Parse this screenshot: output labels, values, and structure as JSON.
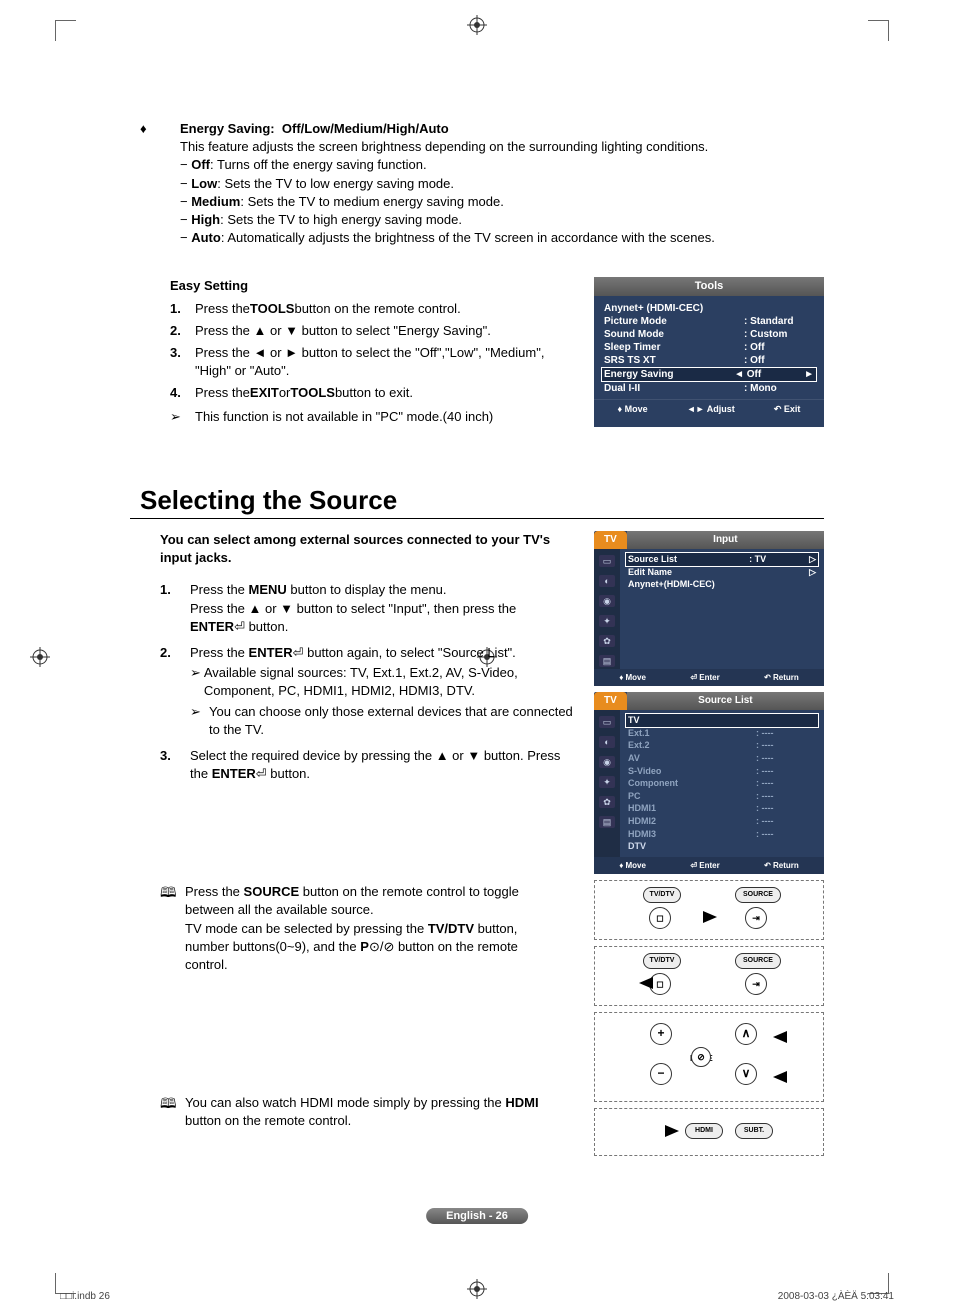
{
  "section1": {
    "title_label": "Energy Saving:",
    "title_options": "Off/Low/Medium/High/Auto",
    "desc": "This feature adjusts the screen brightness depending on the surrounding lighting conditions.",
    "items": [
      {
        "k": "Off",
        "v": ": Turns off the energy saving function."
      },
      {
        "k": "Low",
        "v": ": Sets the TV to low energy saving mode."
      },
      {
        "k": "Medium",
        "v": ": Sets the TV to medium energy saving mode."
      },
      {
        "k": "High",
        "v": ": Sets the TV to high energy saving mode."
      },
      {
        "k": "Auto",
        "v": ": Automatically adjusts the brightness of the TV screen in accordance with the scenes."
      }
    ]
  },
  "easy": {
    "heading": "Easy Setting",
    "steps": [
      {
        "n": "1.",
        "pre": "Press the ",
        "b": "TOOLS",
        "post": " button on the remote control."
      },
      {
        "n": "2.",
        "pre": "Press the ▲ or ▼ button to select \"Energy Saving\".",
        "b": "",
        "post": ""
      },
      {
        "n": "3.",
        "pre": "Press the ◄ or ► button to select the \"Off\",\"Low\", \"Medium\", \"High\" or \"Auto\".",
        "b": "",
        "post": ""
      },
      {
        "n": "4.",
        "pre": "Press the ",
        "b": "EXIT",
        "mid": " or ",
        "b2": "TOOLS",
        "post": " button to exit."
      }
    ],
    "note": "This function is not available in \"PC\" mode.(40 inch)"
  },
  "tools": {
    "title": "Tools",
    "rows": [
      {
        "l": "Anynet+ (HDMI-CEC)",
        "v": ""
      },
      {
        "l": "Picture Mode",
        "v": ": Standard"
      },
      {
        "l": "Sound Mode",
        "v": ": Custom"
      },
      {
        "l": "Sleep Timer",
        "v": ": Off"
      },
      {
        "l": "SRS TS XT",
        "v": ": Off"
      },
      {
        "l": "Energy Saving",
        "v": "◄ Off",
        "arrow_r": "►",
        "hl": true
      },
      {
        "l": "Dual I-II",
        "v": ": Mono"
      }
    ],
    "footer": {
      "move": "Move",
      "adjust": "Adjust",
      "exit": "Exit"
    }
  },
  "sourceSection": {
    "heading": "Selecting the Source",
    "intro": "You can select among external sources connected to your TV's input jacks.",
    "steps": [
      {
        "n": "1.",
        "lines": [
          "Press the <b>MENU</b> button to display the menu.",
          "Press the ▲ or ▼ button to select \"Input\", then press the <b>ENTER</b>⏎ button."
        ]
      },
      {
        "n": "2.",
        "lines": [
          "Press the <b>ENTER</b>⏎ button again, to select \"Source List\"."
        ],
        "sub": [
          "Available signal sources:  TV, Ext.1, Ext.2, AV, S-Video, Component, PC, HDMI1, HDMI2, HDMI3, DTV.",
          "You can choose only those external devices that are connected to the TV."
        ]
      },
      {
        "n": "3.",
        "lines": [
          "Select the required device by pressing the ▲ or ▼ button. Press the <b>ENTER</b>⏎ button."
        ]
      }
    ],
    "note1": "Press the <b>SOURCE</b> button on the remote control to toggle between all the available source.<br>TV mode can be selected by pressing the <b>TV/DTV</b> button, number buttons(0~9), and the <b>P</b>⊙/⊘ button on the remote control.",
    "note2": "You can also watch HDMI mode simply by pressing the <b>HDMI</b> button on the remote control."
  },
  "osd_input": {
    "tab": "TV",
    "title": "Input",
    "rows": [
      {
        "l": "Source List",
        "v": ": TV",
        "arrow": "▷",
        "hl": true
      },
      {
        "l": "Edit Name",
        "v": "",
        "arrow": "▷"
      },
      {
        "l": "Anynet+(HDMI-CEC)",
        "v": "",
        "arrow": ""
      }
    ],
    "footer": {
      "move": "Move",
      "enter": "Enter",
      "return": "Return"
    }
  },
  "osd_source": {
    "tab": "TV",
    "title": "Source List",
    "rows": [
      {
        "l": "TV",
        "v": "",
        "hl": true
      },
      {
        "l": "Ext.1",
        "v": ": ----"
      },
      {
        "l": "Ext.2",
        "v": ": ----"
      },
      {
        "l": "AV",
        "v": ": ----"
      },
      {
        "l": "S-Video",
        "v": ": ----"
      },
      {
        "l": "Component",
        "v": ": ----"
      },
      {
        "l": "PC",
        "v": ": ----"
      },
      {
        "l": "HDMI1",
        "v": ": ----"
      },
      {
        "l": "HDMI2",
        "v": ": ----"
      },
      {
        "l": "HDMI3",
        "v": ": ----"
      },
      {
        "l": "DTV",
        "v": ""
      }
    ],
    "footer": {
      "move": "Move",
      "enter": "Enter",
      "return": "Return"
    }
  },
  "remote": {
    "tvdtv": "TV/DTV",
    "source": "SOURCE",
    "mute": "MUTE",
    "hdmi": "HDMI",
    "subt": "SUBT."
  },
  "pageNum": "English - 26",
  "footerLeft": "□□i.indb   26",
  "footerRight": "2008-03-03   ¿ÀÈÄ 5:03:41"
}
